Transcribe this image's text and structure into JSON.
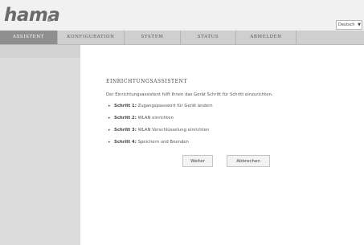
{
  "brand": {
    "logo_text": "hama"
  },
  "language": {
    "selected": "Deutsch"
  },
  "nav": {
    "tabs": [
      {
        "label": "ASSISTENT"
      },
      {
        "label": "KONFIGURATION"
      },
      {
        "label": "SYSTEM"
      },
      {
        "label": "STATUS"
      },
      {
        "label": "ABMELDEN"
      }
    ]
  },
  "wizard": {
    "title": "EINRICHTUNGSASSISTENT",
    "intro": "Der Einrichtungsassistent hilft Ihnen das Gerät Schritt für Schritt einzurichten.",
    "steps": [
      {
        "label": "Schritt 1:",
        "text": "Zugangspasswort für Gerät ändern"
      },
      {
        "label": "Schritt 2:",
        "text": "WLAN einrichten"
      },
      {
        "label": "Schritt 3:",
        "text": "WLAN Verschlüsselung einrichten"
      },
      {
        "label": "Schritt 4:",
        "text": "Speichern und Beenden"
      }
    ],
    "next_label": "Weiter",
    "cancel_label": "Abbrechen"
  },
  "colors": {
    "active_tab": "#8f8f8f",
    "nav_bar": "#cfcfcf",
    "sidebar": "#dcdcdc"
  }
}
